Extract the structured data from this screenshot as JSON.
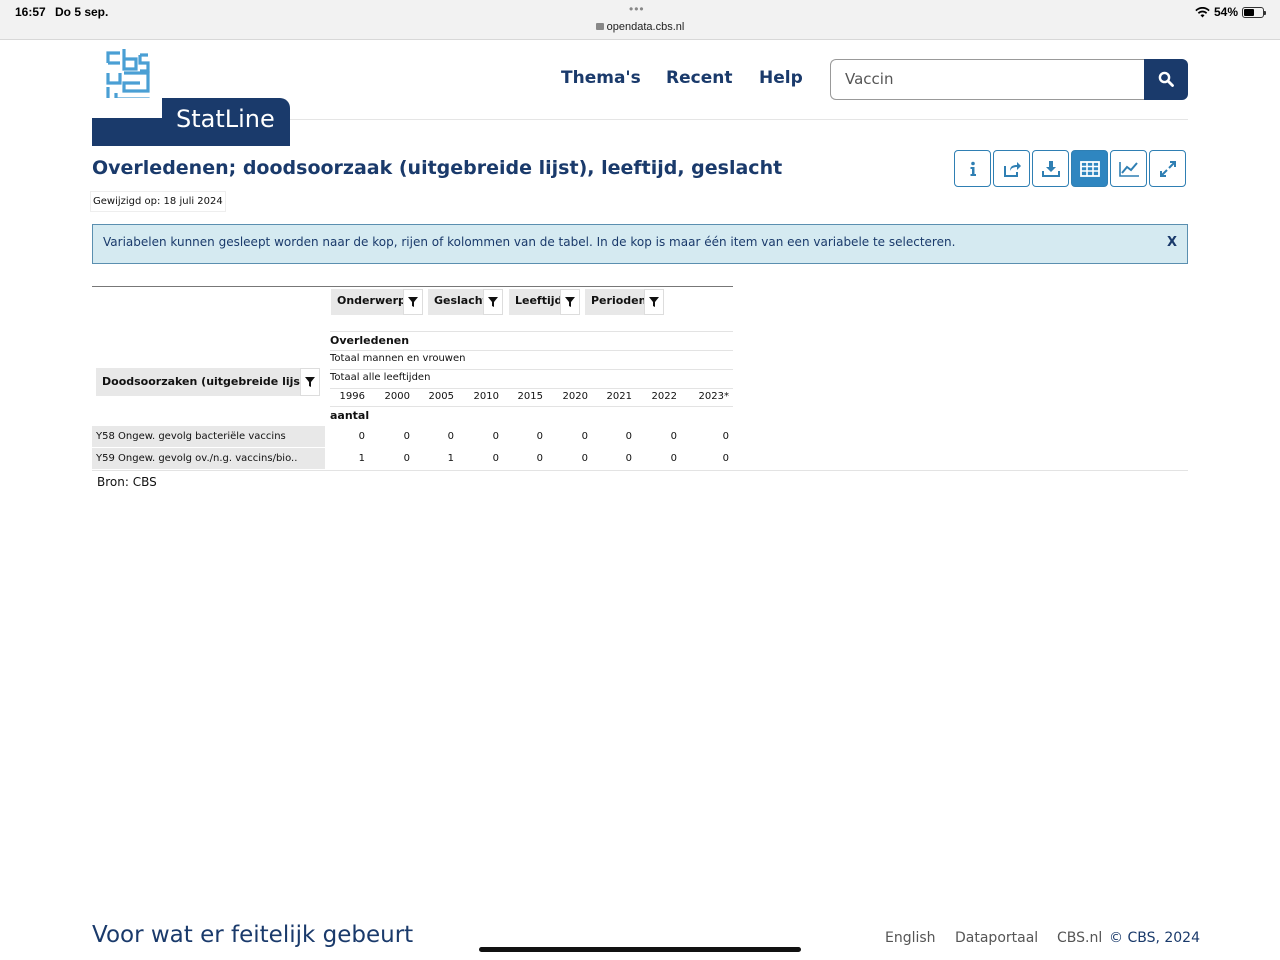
{
  "status_bar": {
    "time": "16:57",
    "date": "Do 5 sep.",
    "url": "opendata.cbs.nl",
    "battery": "54%"
  },
  "header": {
    "logo_text": "StatLine",
    "nav": [
      "Thema's",
      "Recent",
      "Help"
    ],
    "search_value": "Vaccin"
  },
  "page": {
    "title": "Overledenen; doodsoorzaak (uitgebreide lijst), leeftijd, geslacht",
    "modified": "Gewijzigd op: 18 juli 2024",
    "alert": "Variabelen kunnen gesleept worden naar de kop, rijen of kolommen van de tabel. In de kop is maar één item van een variabele te selecteren.",
    "alert_close": "X"
  },
  "toolbar": {
    "icons": [
      "info-icon",
      "share-icon",
      "download-icon",
      "table-icon",
      "chart-icon",
      "fullscreen-icon"
    ],
    "active": "table-icon",
    "accent": "#2f86c0"
  },
  "table": {
    "column_chips": [
      "Onderwerp",
      "Geslacht",
      "Leeftijd",
      "Perioden"
    ],
    "row_chip": "Doodsoorzaken (uitgebreide lijst)",
    "header_rows": [
      "Overledenen",
      "Totaal mannen en vrouwen",
      "Totaal alle leeftijden"
    ],
    "years": [
      "1996",
      "2000",
      "2005",
      "2010",
      "2015",
      "2020",
      "2021",
      "2022",
      "2023*"
    ],
    "unit": "aantal",
    "rows": [
      {
        "label": "Y58 Ongew. gevolg bacteriële vaccins",
        "values": [
          "0",
          "0",
          "0",
          "0",
          "0",
          "0",
          "0",
          "0",
          "0"
        ]
      },
      {
        "label": "Y59 Ongew. gevolg ov./n.g. vaccins/bio..",
        "values": [
          "1",
          "0",
          "1",
          "0",
          "0",
          "0",
          "0",
          "0",
          "0"
        ]
      }
    ],
    "source": "Bron: CBS"
  },
  "footer": {
    "slogan": "Voor wat er feitelijk gebeurt",
    "links": [
      "English",
      "Dataportaal",
      "CBS.nl"
    ],
    "copyright": "© CBS, 2024"
  }
}
